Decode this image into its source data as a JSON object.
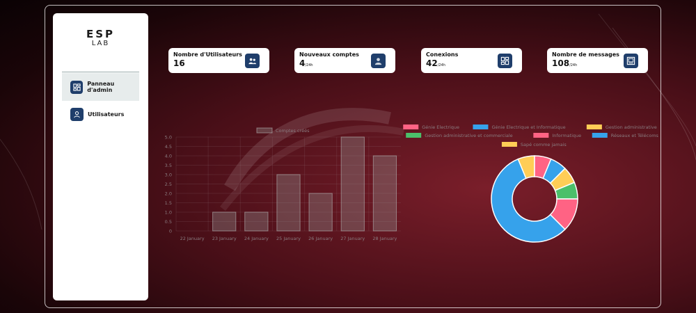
{
  "brand": {
    "line1": "ESP",
    "line2": "LAB"
  },
  "sidebar": {
    "items": [
      {
        "label": "Panneau d'admin",
        "icon": "dashboard-icon",
        "active": true
      },
      {
        "label": "Utilisateurs",
        "icon": "user-icon",
        "active": false
      }
    ]
  },
  "cards": [
    {
      "title": "Nombre d'Utilisateurs",
      "value": "16",
      "unit": "",
      "icon": "users-icon"
    },
    {
      "title": "Nouveaux comptes",
      "value": "4",
      "unit": "/24h",
      "icon": "new-account-icon"
    },
    {
      "title": "Conexions",
      "value": "42",
      "unit": "/24h",
      "icon": "connections-icon"
    },
    {
      "title": "Nombre de messages",
      "value": "108",
      "unit": "/24h",
      "icon": "messages-icon"
    }
  ],
  "colors": {
    "accent": "#1f3e6b",
    "bar_fill": "rgba(150,150,150,0.35)",
    "bar_stroke": "rgba(180,180,180,0.6)"
  },
  "chart_data": [
    {
      "type": "bar",
      "categories": [
        "22 January",
        "23 January",
        "24 January",
        "25 January",
        "26 January",
        "27 January",
        "28 January"
      ],
      "series": [
        {
          "name": "Comptes créés",
          "values": [
            0,
            1,
            1,
            3,
            2,
            5,
            4
          ]
        }
      ],
      "ylim": [
        0,
        5
      ],
      "yticks": [
        "0",
        "0.5",
        "1.0",
        "1.5",
        "2.0",
        "2.5",
        "3.0",
        "3.5",
        "4.0",
        "4.5",
        "5.0"
      ],
      "legend_position": "top",
      "grid": true
    },
    {
      "type": "pie",
      "labels": [
        "Génie Electrique",
        "Génie Electrique et Informatique",
        "Gestion administrative",
        "Gestion administrative et commerciale",
        "Informatique",
        "Réseaux et Télécoms",
        "Sapé comme jamais"
      ],
      "values": [
        1,
        1,
        1,
        1,
        2,
        9,
        1
      ],
      "colors": [
        "#ff6384",
        "#36a2eb",
        "#ffcd56",
        "#4bc06a",
        "#ff6384",
        "#36a2eb",
        "#ffcd56"
      ],
      "slice_order": [
        6,
        0,
        1,
        2,
        3,
        4,
        5
      ],
      "legend_position": "top"
    }
  ]
}
